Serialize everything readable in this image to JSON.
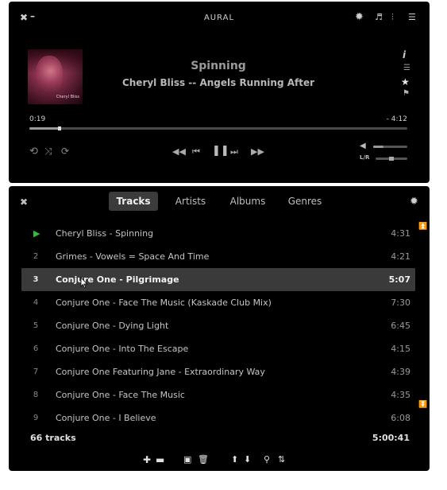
{
  "player": {
    "app_title": "AURAL",
    "icons": {
      "close": "✖",
      "minimize": "–",
      "settings": "✹",
      "playlist": "♬",
      "effects": "⫶",
      "layout": "☰",
      "info": "i",
      "lyrics": "☰",
      "favorite": "★",
      "bookmark": "⚑",
      "repeat": "⟲",
      "shuffle": "⤨",
      "loop": "⟳",
      "seek_back": "◀◀",
      "prev": "⏮",
      "pause": "❚❚",
      "next": "⏭",
      "seek_fwd": "▶▶",
      "volume": "◀"
    },
    "track_title": "Spinning",
    "track_artist_album": "Cheryl Bliss -- Angels Running After",
    "album_art_text": "Cheryl Bliss",
    "time_elapsed": "0:19",
    "time_remaining": "- 4:12",
    "seek_progress": 0.08,
    "volume_level": 0.3,
    "balance_label": "L/R",
    "balance_position": 0.5,
    "colors": {
      "background": "#000000",
      "playing_indicator": "#2fbe3c"
    }
  },
  "playlist": {
    "close_icon": "✖",
    "settings_icon": "✹",
    "tabs": [
      {
        "label": "Tracks",
        "active": true
      },
      {
        "label": "Artists",
        "active": false
      },
      {
        "label": "Albums",
        "active": false
      },
      {
        "label": "Genres",
        "active": false
      }
    ],
    "tracks": [
      {
        "num": "",
        "title": "Cheryl Bliss - Spinning",
        "duration": "4:31",
        "playing": true,
        "selected": false
      },
      {
        "num": "2",
        "title": "Grimes - Vowels = Space And Time",
        "duration": "4:21",
        "playing": false,
        "selected": false
      },
      {
        "num": "3",
        "title": "Conjure One - Pilgrimage",
        "duration": "5:07",
        "playing": false,
        "selected": true
      },
      {
        "num": "4",
        "title": "Conjure One - Face The Music (Kaskade Club Mix)",
        "duration": "7:30",
        "playing": false,
        "selected": false
      },
      {
        "num": "5",
        "title": "Conjure One - Dying Light",
        "duration": "6:45",
        "playing": false,
        "selected": false
      },
      {
        "num": "6",
        "title": "Conjure One - Into The Escape",
        "duration": "4:15",
        "playing": false,
        "selected": false
      },
      {
        "num": "7",
        "title": "Conjure One Featuring Jane - Extraordinary Way",
        "duration": "4:39",
        "playing": false,
        "selected": false
      },
      {
        "num": "8",
        "title": "Conjure One - Face The Music",
        "duration": "4:35",
        "playing": false,
        "selected": false
      },
      {
        "num": "9",
        "title": "Conjure One - I Believe",
        "duration": "6:08",
        "playing": false,
        "selected": false
      }
    ],
    "playing_icon": "▶",
    "scroll_top_icon": "⏫",
    "scroll_bottom_icon": "⏬",
    "track_count": "66 tracks",
    "total_duration": "5:00:41",
    "toolbar": {
      "add_icon": "✚",
      "remove_icon": "▬",
      "save_icon": "▣",
      "delete_icon": "🗑",
      "move_up_icon": "⬆",
      "move_down_icon": "⬇",
      "search_icon": "⚲",
      "sort_icon": "⇅"
    }
  }
}
